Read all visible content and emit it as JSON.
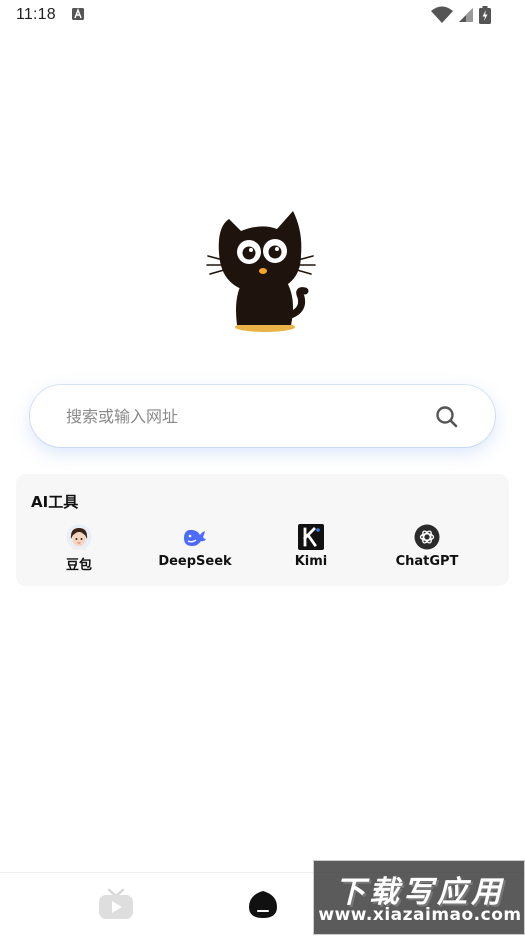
{
  "status_bar": {
    "time": "11:18",
    "icons": [
      "keyboard-a-icon",
      "wifi-icon",
      "signal-icon",
      "battery-charging-icon"
    ]
  },
  "logo": {
    "icon": "black-cat-logo"
  },
  "search": {
    "placeholder": "搜索或输入网址",
    "value": "",
    "icon": "search-icon"
  },
  "ai_tools": {
    "title": "AI工具",
    "items": [
      {
        "label": "豆包",
        "icon": "doubao-avatar-icon"
      },
      {
        "label": "DeepSeek",
        "icon": "deepseek-whale-icon"
      },
      {
        "label": "Kimi",
        "icon": "kimi-k-icon"
      },
      {
        "label": "ChatGPT",
        "icon": "chatgpt-knot-icon"
      }
    ]
  },
  "bottom_nav": {
    "tabs": [
      {
        "icon": "tv-play-icon",
        "active": false
      },
      {
        "icon": "home-blob-icon",
        "active": true
      }
    ]
  },
  "watermark": {
    "title": "下载写应用",
    "url": "www.xiazaimao.com"
  },
  "colors": {
    "search_shadow": "#5a8ce6",
    "card_bg": "#f7f7f8",
    "deepseek_blue": "#4d6bfe",
    "cat_eye": "#ffffff",
    "cat_nose": "#f5a623"
  }
}
